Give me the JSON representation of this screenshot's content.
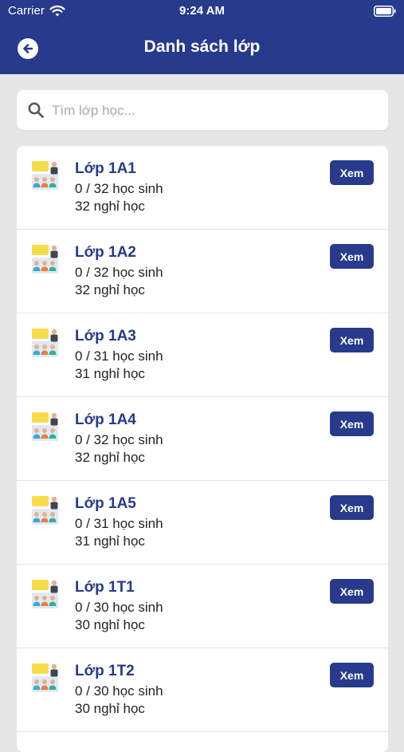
{
  "status": {
    "carrier": "Carrier",
    "time": "9:24 AM",
    "wifi_icon": "wifi-icon",
    "battery_icon": "battery-icon"
  },
  "header": {
    "title": "Danh sách lớp",
    "back_icon": "back-arrow-icon",
    "background": "#273a8c"
  },
  "search": {
    "placeholder": "Tìm lớp học...",
    "value": "",
    "icon": "search-icon"
  },
  "classes": [
    {
      "name": "Lớp 1A1",
      "count": "0 / 32 học sinh",
      "absent": "32 nghỉ học",
      "button": "Xem"
    },
    {
      "name": "Lớp 1A2",
      "count": "0 / 32 học sinh",
      "absent": "32 nghỉ học",
      "button": "Xem"
    },
    {
      "name": "Lớp 1A3",
      "count": "0 / 31 học sinh",
      "absent": "31 nghỉ học",
      "button": "Xem"
    },
    {
      "name": "Lớp 1A4",
      "count": "0 / 32 học sinh",
      "absent": "32 nghỉ học",
      "button": "Xem"
    },
    {
      "name": "Lớp 1A5",
      "count": "0 / 31 học sinh",
      "absent": "31 nghỉ học",
      "button": "Xem"
    },
    {
      "name": "Lớp 1T1",
      "count": "0 / 30 học sinh",
      "absent": "30 nghỉ học",
      "button": "Xem"
    },
    {
      "name": "Lớp 1T2",
      "count": "0 / 30 học sinh",
      "absent": "30 nghỉ học",
      "button": "Xem"
    }
  ],
  "colors": {
    "accent": "#273a8c",
    "background": "#e6e6e6"
  }
}
